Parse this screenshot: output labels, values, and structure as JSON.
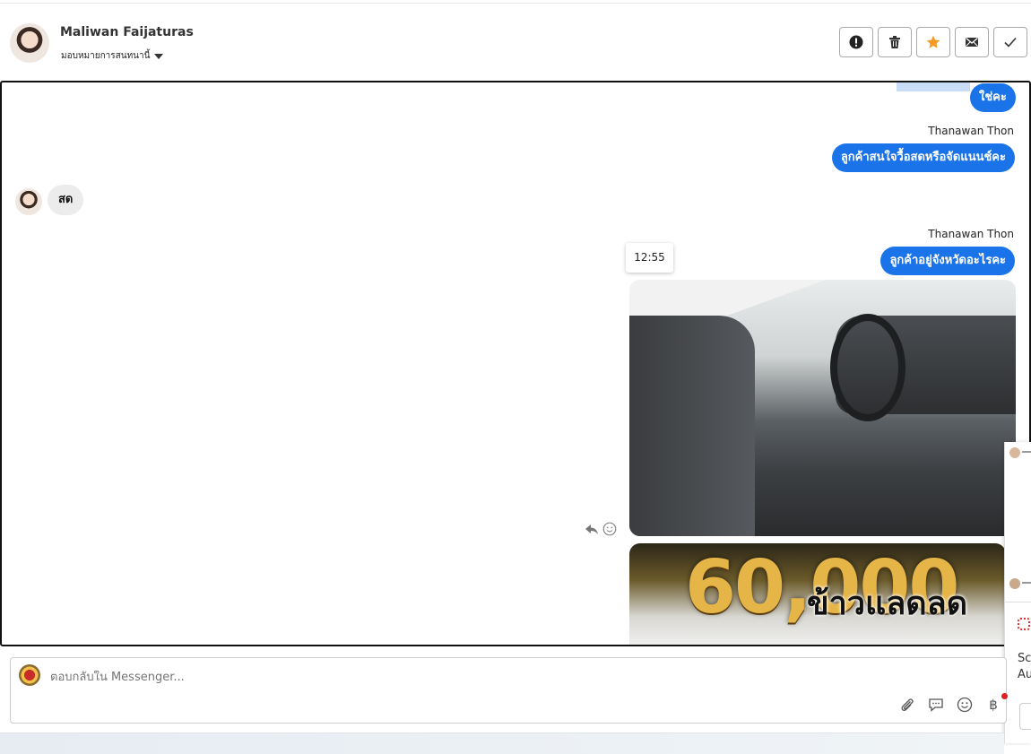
{
  "header": {
    "contact_name": "Maliwan Faijaturas",
    "assign_label": "มอบหมายการสนทนานี้",
    "actions": [
      {
        "icon": "alert-icon",
        "name": "alert-button"
      },
      {
        "icon": "trash-icon",
        "name": "delete-button"
      },
      {
        "icon": "star-icon",
        "name": "star-button",
        "color": "#f59a23"
      },
      {
        "icon": "mail-icon",
        "name": "mail-button"
      },
      {
        "icon": "check-icon",
        "name": "done-button"
      }
    ]
  },
  "messages": {
    "m1_text": "ใช่คะ",
    "m2_sender": "Thanawan Thon",
    "m2_text": "ลูกค้าสนใจวื้อสดหรือจัดแนนช์คะ",
    "m3_text": "สด",
    "m4_sender": "Thanawan Thon",
    "m4_text": "ลูกค้าอยู่จังหวัดอะไรคะ",
    "timestamp": "12:55",
    "promo_number": "60,000",
    "promo_text": "ข้าวแลดลด"
  },
  "composer": {
    "placeholder": "ตอบกลับใน Messenger...",
    "currency_symbol": "฿"
  },
  "side_notification": {
    "text1": "Sc",
    "text2": "Au"
  },
  "colors": {
    "outgoing_bubble": "#1a73e8",
    "incoming_bubble": "#ececec",
    "star": "#f59a23"
  }
}
